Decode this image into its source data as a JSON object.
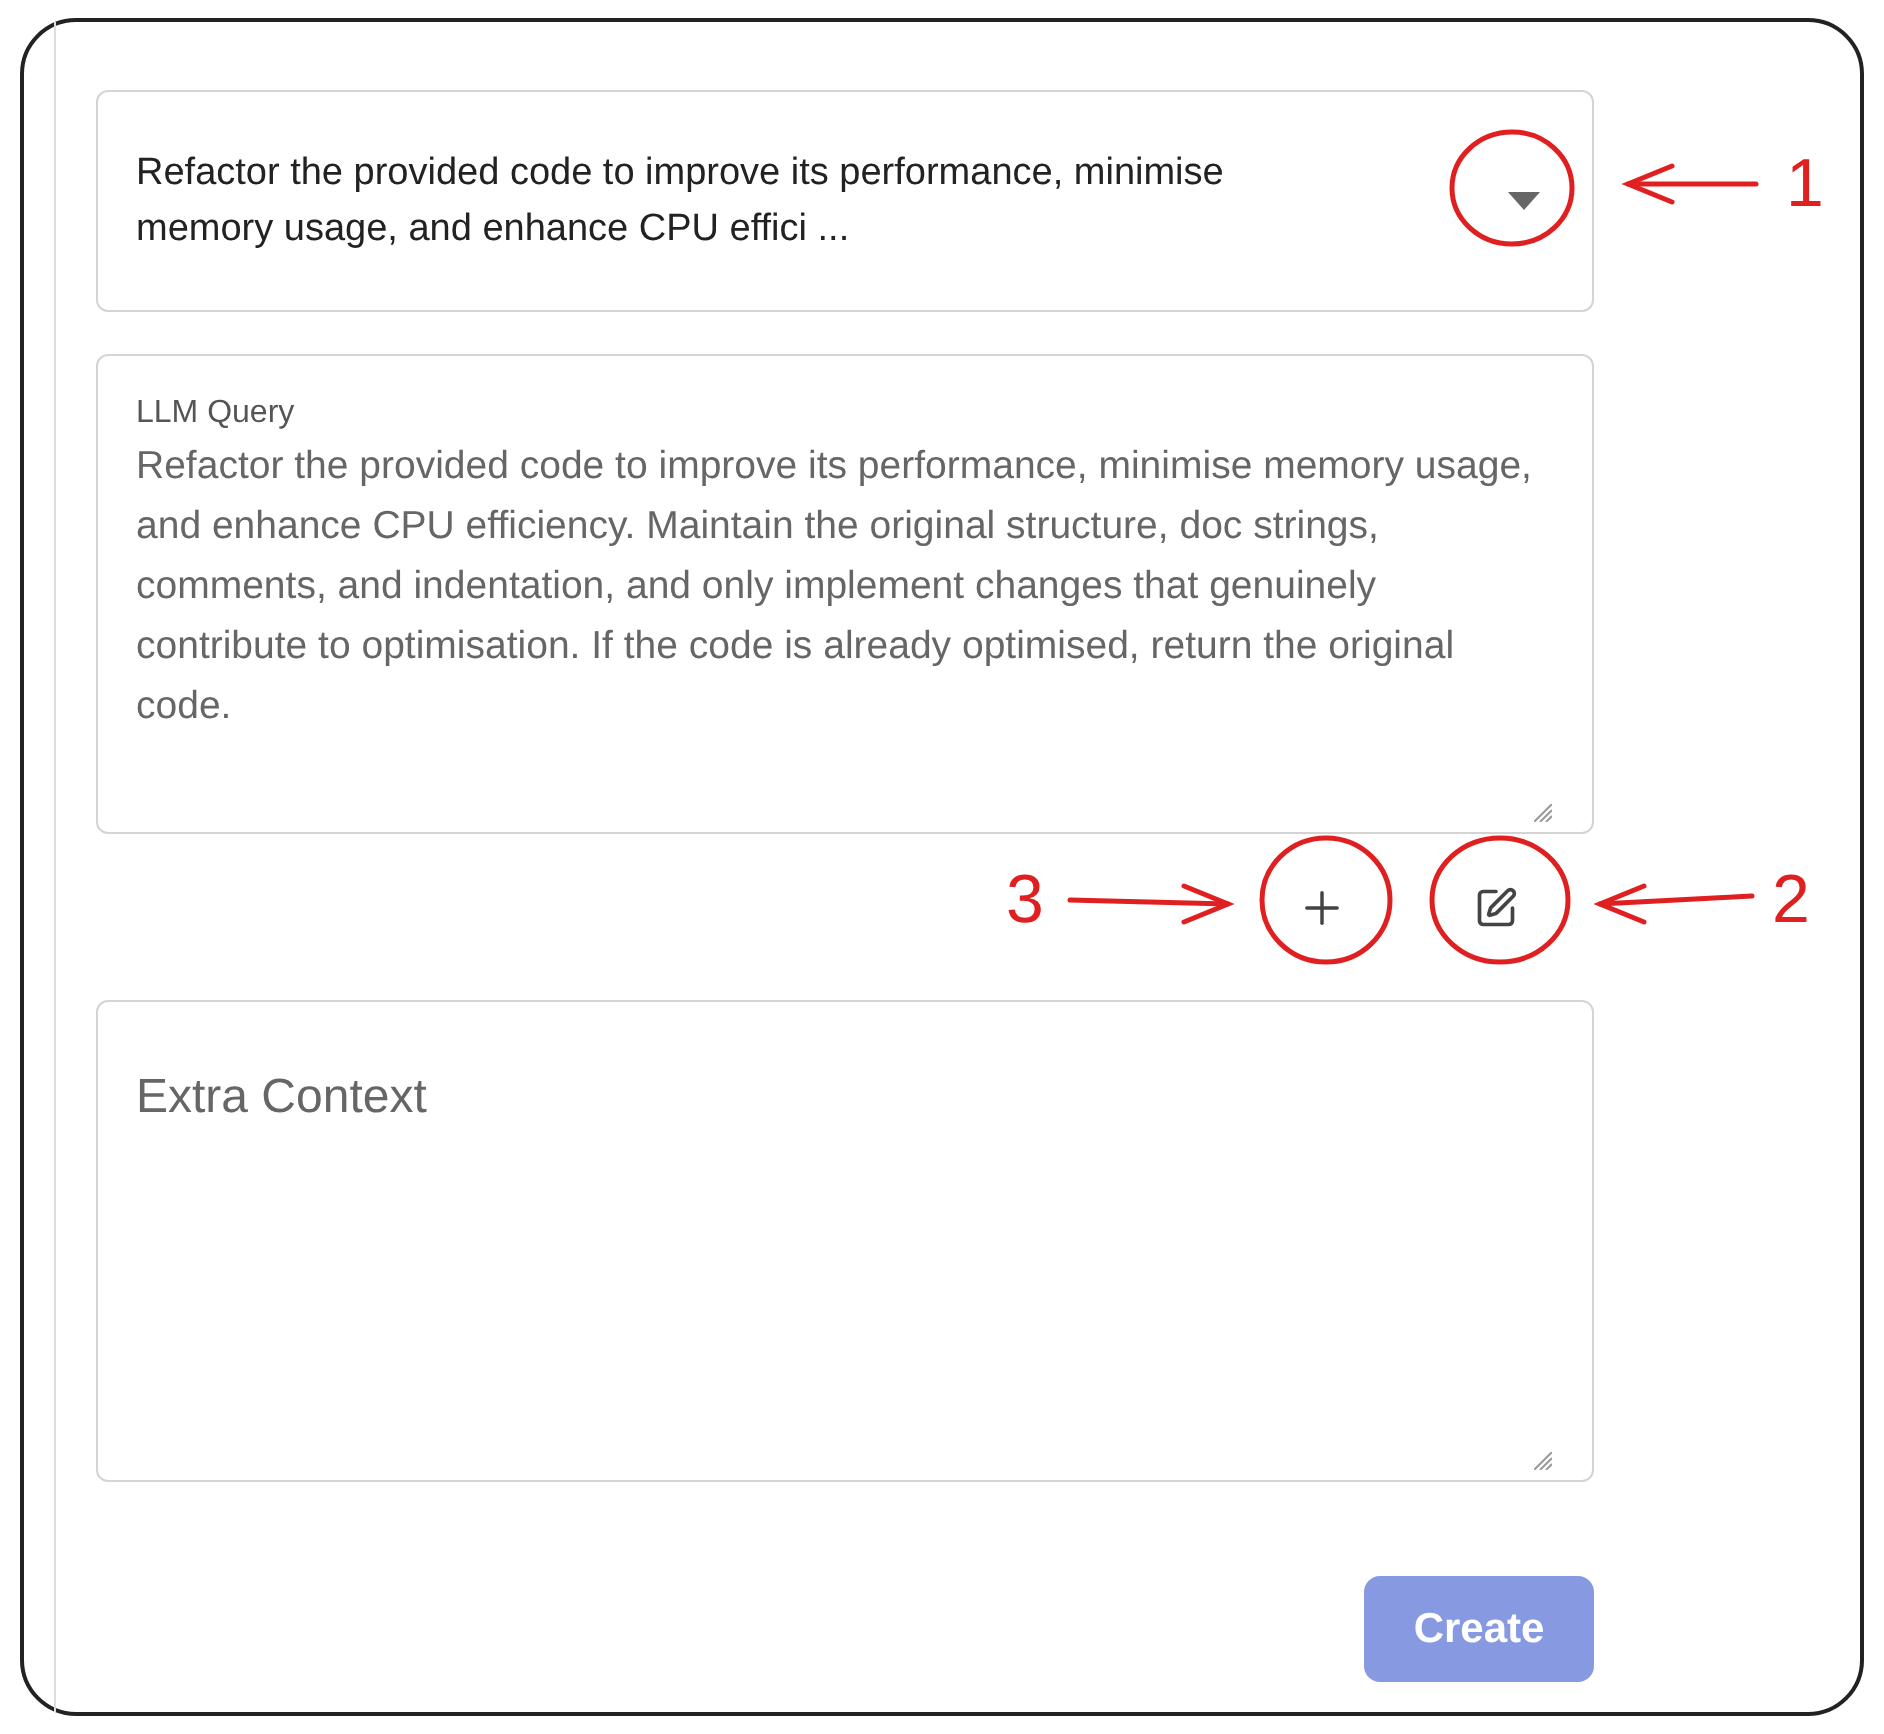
{
  "prompt_select": {
    "value": "Refactor the provided code to improve its performance, minimise memory usage, and enhance CPU effici ...",
    "expanded": false
  },
  "query_field": {
    "label": "LLM Query",
    "value": "Refactor the provided code to improve its performance, minimise memory usage, and enhance CPU efficiency. Maintain the original structure, doc strings, comments, and indentation, and only implement changes that genuinely contribute to optimisation. If the code is already optimised, return the original code."
  },
  "context_field": {
    "placeholder": "Extra Context"
  },
  "create_button": {
    "label": "Create",
    "disabled": true
  },
  "annotations": [
    {
      "label": "1"
    },
    {
      "label": "2"
    },
    {
      "label": "3"
    }
  ]
}
